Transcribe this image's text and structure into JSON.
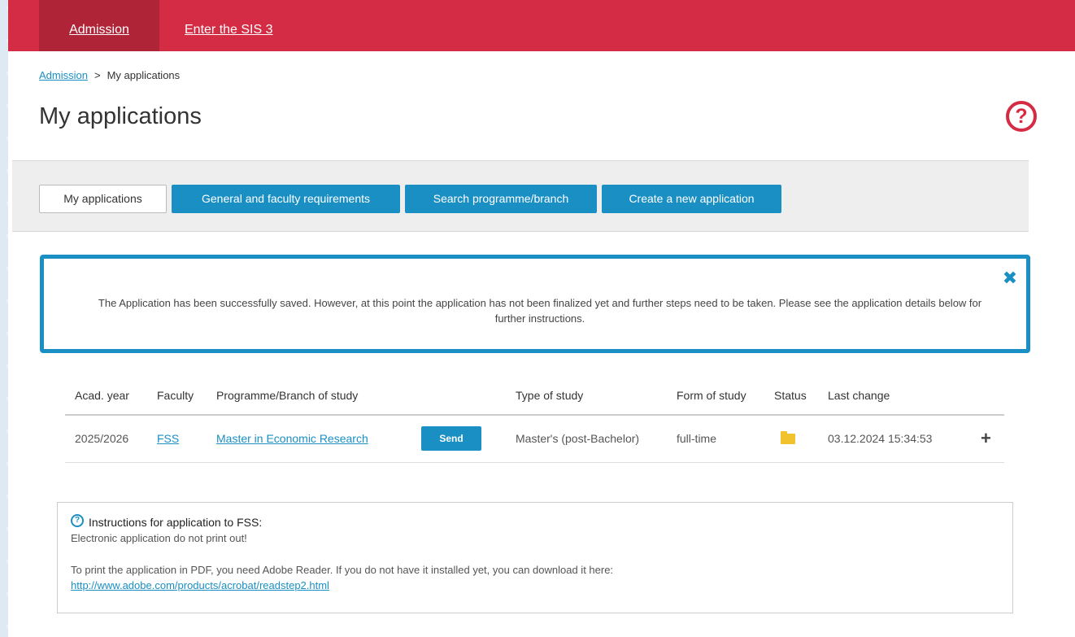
{
  "nav": {
    "admission": "Admission",
    "sis": "Enter the SIS 3"
  },
  "breadcrumb": {
    "link": "Admission",
    "separator": ">",
    "current": "My applications"
  },
  "page_title": "My applications",
  "help_symbol": "?",
  "tabs": {
    "my": "My applications",
    "general": "General and faculty requirements",
    "search": "Search programme/branch",
    "create": "Create a new application"
  },
  "alert": {
    "text": "The Application has been successfully saved. However, at this point the application has not been finalized yet and further steps need to be taken. Please see the application details below for further instructions.",
    "close_symbol": "✖"
  },
  "table": {
    "headers": [
      "Acad. year",
      "Faculty",
      "Programme/Branch of study",
      "",
      "Type of study",
      "Form of study",
      "Status",
      "Last change",
      ""
    ],
    "rows": [
      {
        "year": "2025/2026",
        "faculty": "FSS",
        "programme": "Master in Economic Research",
        "action": "Send",
        "type": "Master's (post-Bachelor)",
        "form": "full-time",
        "status_icon": "folder-icon",
        "last_change": "03.12.2024 15:34:53",
        "expand_symbol": "+"
      }
    ]
  },
  "instructions": {
    "icon_symbol": "?",
    "title": "Instructions for application to FSS:",
    "line1": "Electronic application do not print out!",
    "line2": "To print the application in PDF, you need Adobe Reader. If you do not have it installed yet, you can download it here:",
    "link": "http://www.adobe.com/products/acrobat/readstep2.html"
  },
  "colors": {
    "brand_red": "#d42c44",
    "nav_active": "#b02438",
    "accent_blue": "#1a8fc4",
    "folder_yellow": "#f2c12e"
  }
}
